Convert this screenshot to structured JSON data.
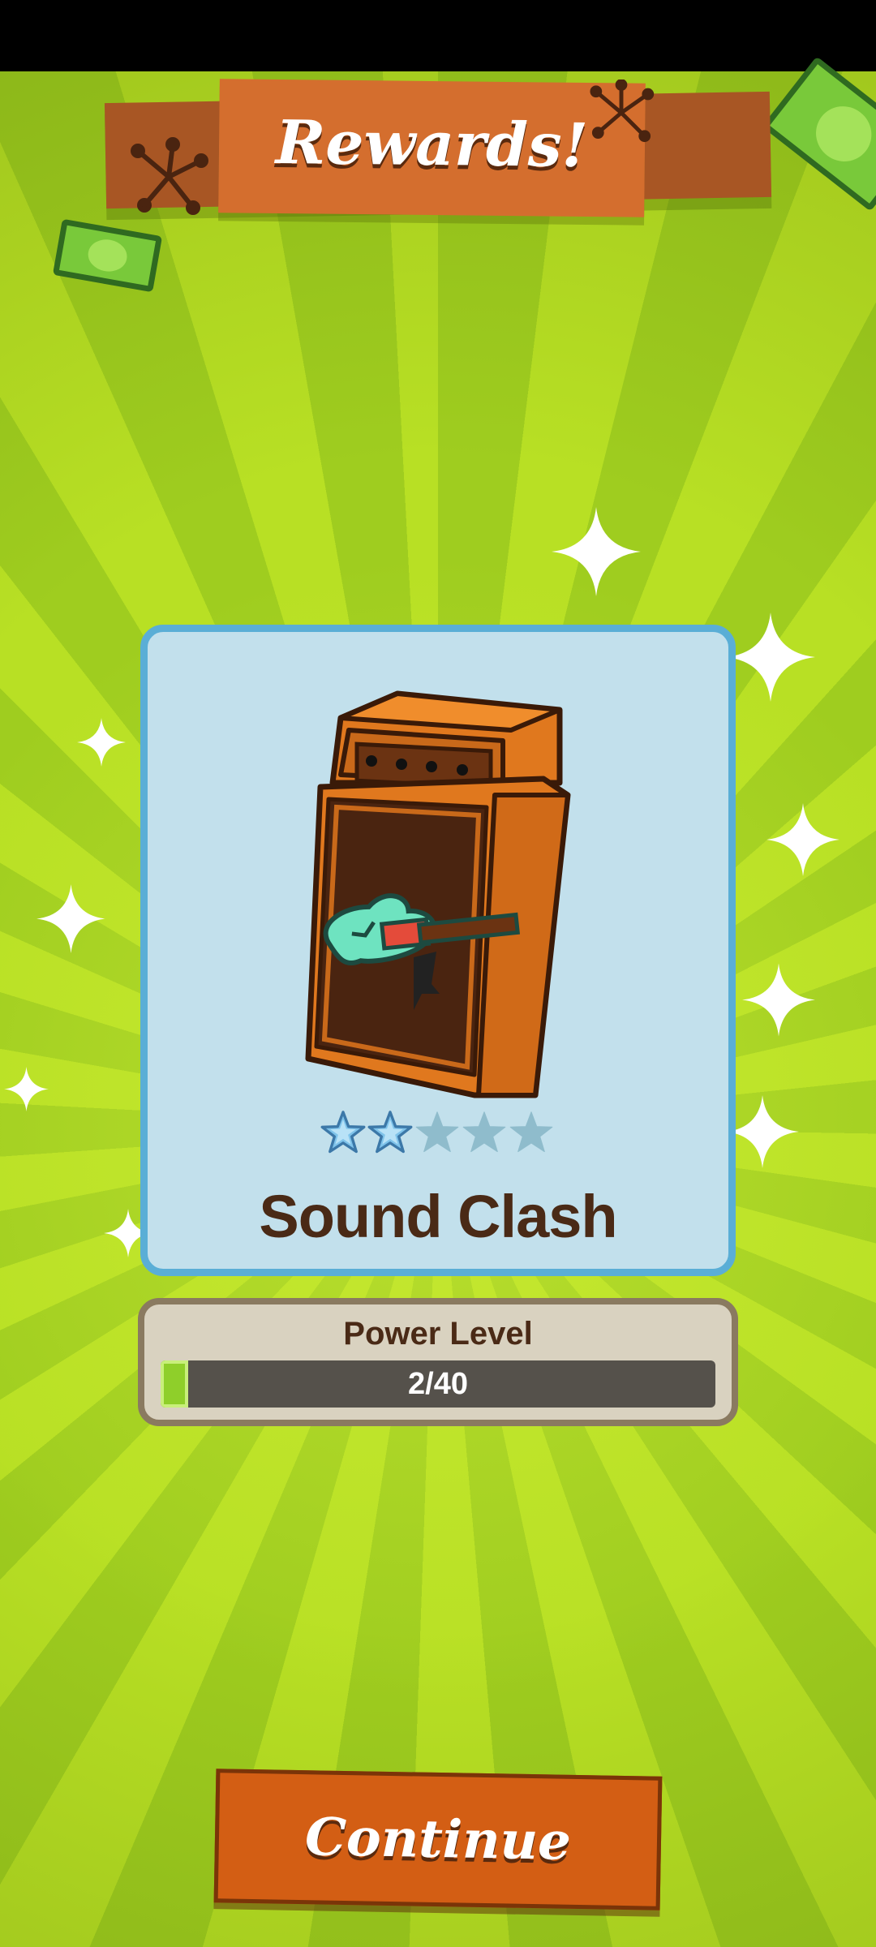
{
  "header": {
    "title": "Rewards!"
  },
  "reward": {
    "name": "Sound Clash",
    "stars_filled": 2,
    "stars_total": 5,
    "image_icon": "guitar-amp-icon"
  },
  "power_level": {
    "label": "Power Level",
    "current": 2,
    "max": 40,
    "text": "2/40"
  },
  "continue_button": {
    "label": "Continue"
  },
  "colors": {
    "star_filled": "#7fc3ea",
    "star_empty": "#8fbccc",
    "accent_orange": "#d35e14",
    "card_bg": "#c2e0ec",
    "progress_fill": "#8fcf2a"
  }
}
